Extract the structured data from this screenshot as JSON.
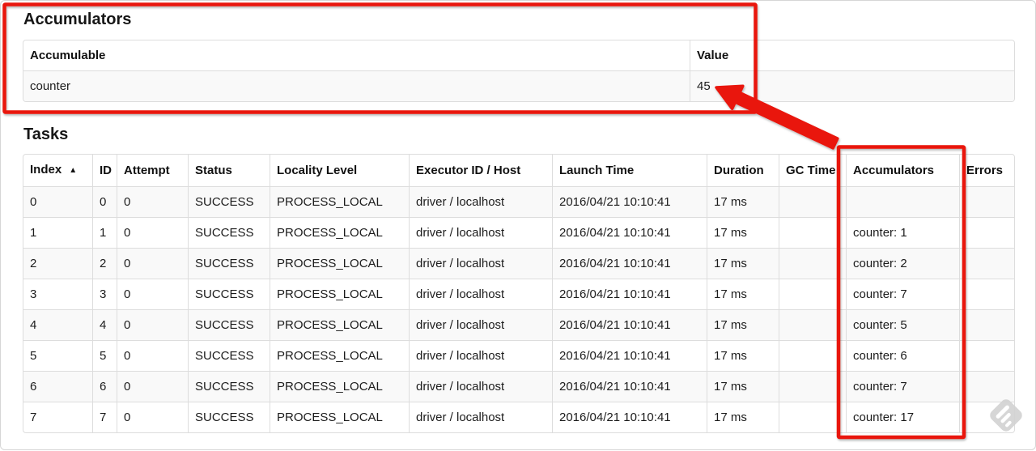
{
  "accumulators_section": {
    "title": "Accumulators",
    "table": {
      "columns": [
        "Accumulable",
        "Value"
      ],
      "rows": [
        {
          "accumulable": "counter",
          "value": "45"
        }
      ]
    }
  },
  "tasks_section": {
    "title": "Tasks",
    "table": {
      "columns": [
        "Index",
        "ID",
        "Attempt",
        "Status",
        "Locality Level",
        "Executor ID / Host",
        "Launch Time",
        "Duration",
        "GC Time",
        "Accumulators",
        "Errors"
      ],
      "sort": {
        "column": "Index",
        "direction": "ascending",
        "icon": "▲"
      },
      "rows": [
        [
          "0",
          "0",
          "0",
          "SUCCESS",
          "PROCESS_LOCAL",
          "driver / localhost",
          "2016/04/21 10:10:41",
          "17 ms",
          "",
          "",
          ""
        ],
        [
          "1",
          "1",
          "0",
          "SUCCESS",
          "PROCESS_LOCAL",
          "driver / localhost",
          "2016/04/21 10:10:41",
          "17 ms",
          "",
          "counter: 1",
          ""
        ],
        [
          "2",
          "2",
          "0",
          "SUCCESS",
          "PROCESS_LOCAL",
          "driver / localhost",
          "2016/04/21 10:10:41",
          "17 ms",
          "",
          "counter: 2",
          ""
        ],
        [
          "3",
          "3",
          "0",
          "SUCCESS",
          "PROCESS_LOCAL",
          "driver / localhost",
          "2016/04/21 10:10:41",
          "17 ms",
          "",
          "counter: 7",
          ""
        ],
        [
          "4",
          "4",
          "0",
          "SUCCESS",
          "PROCESS_LOCAL",
          "driver / localhost",
          "2016/04/21 10:10:41",
          "17 ms",
          "",
          "counter: 5",
          ""
        ],
        [
          "5",
          "5",
          "0",
          "SUCCESS",
          "PROCESS_LOCAL",
          "driver / localhost",
          "2016/04/21 10:10:41",
          "17 ms",
          "",
          "counter: 6",
          ""
        ],
        [
          "6",
          "6",
          "0",
          "SUCCESS",
          "PROCESS_LOCAL",
          "driver / localhost",
          "2016/04/21 10:10:41",
          "17 ms",
          "",
          "counter: 7",
          ""
        ],
        [
          "7",
          "7",
          "0",
          "SUCCESS",
          "PROCESS_LOCAL",
          "driver / localhost",
          "2016/04/21 10:10:41",
          "17 ms",
          "",
          "counter: 17",
          ""
        ]
      ]
    }
  },
  "annotations": {
    "color": "#e9150d",
    "highlight_accumulators_section": "red box around Accumulators summary table",
    "highlight_accumulators_column": "red box around Accumulators task column",
    "arrow": "arrow pointing from Accumulators column to value 45"
  },
  "watermark": {
    "color": "#d2d2d2",
    "stripe_color": "#ffffff"
  }
}
